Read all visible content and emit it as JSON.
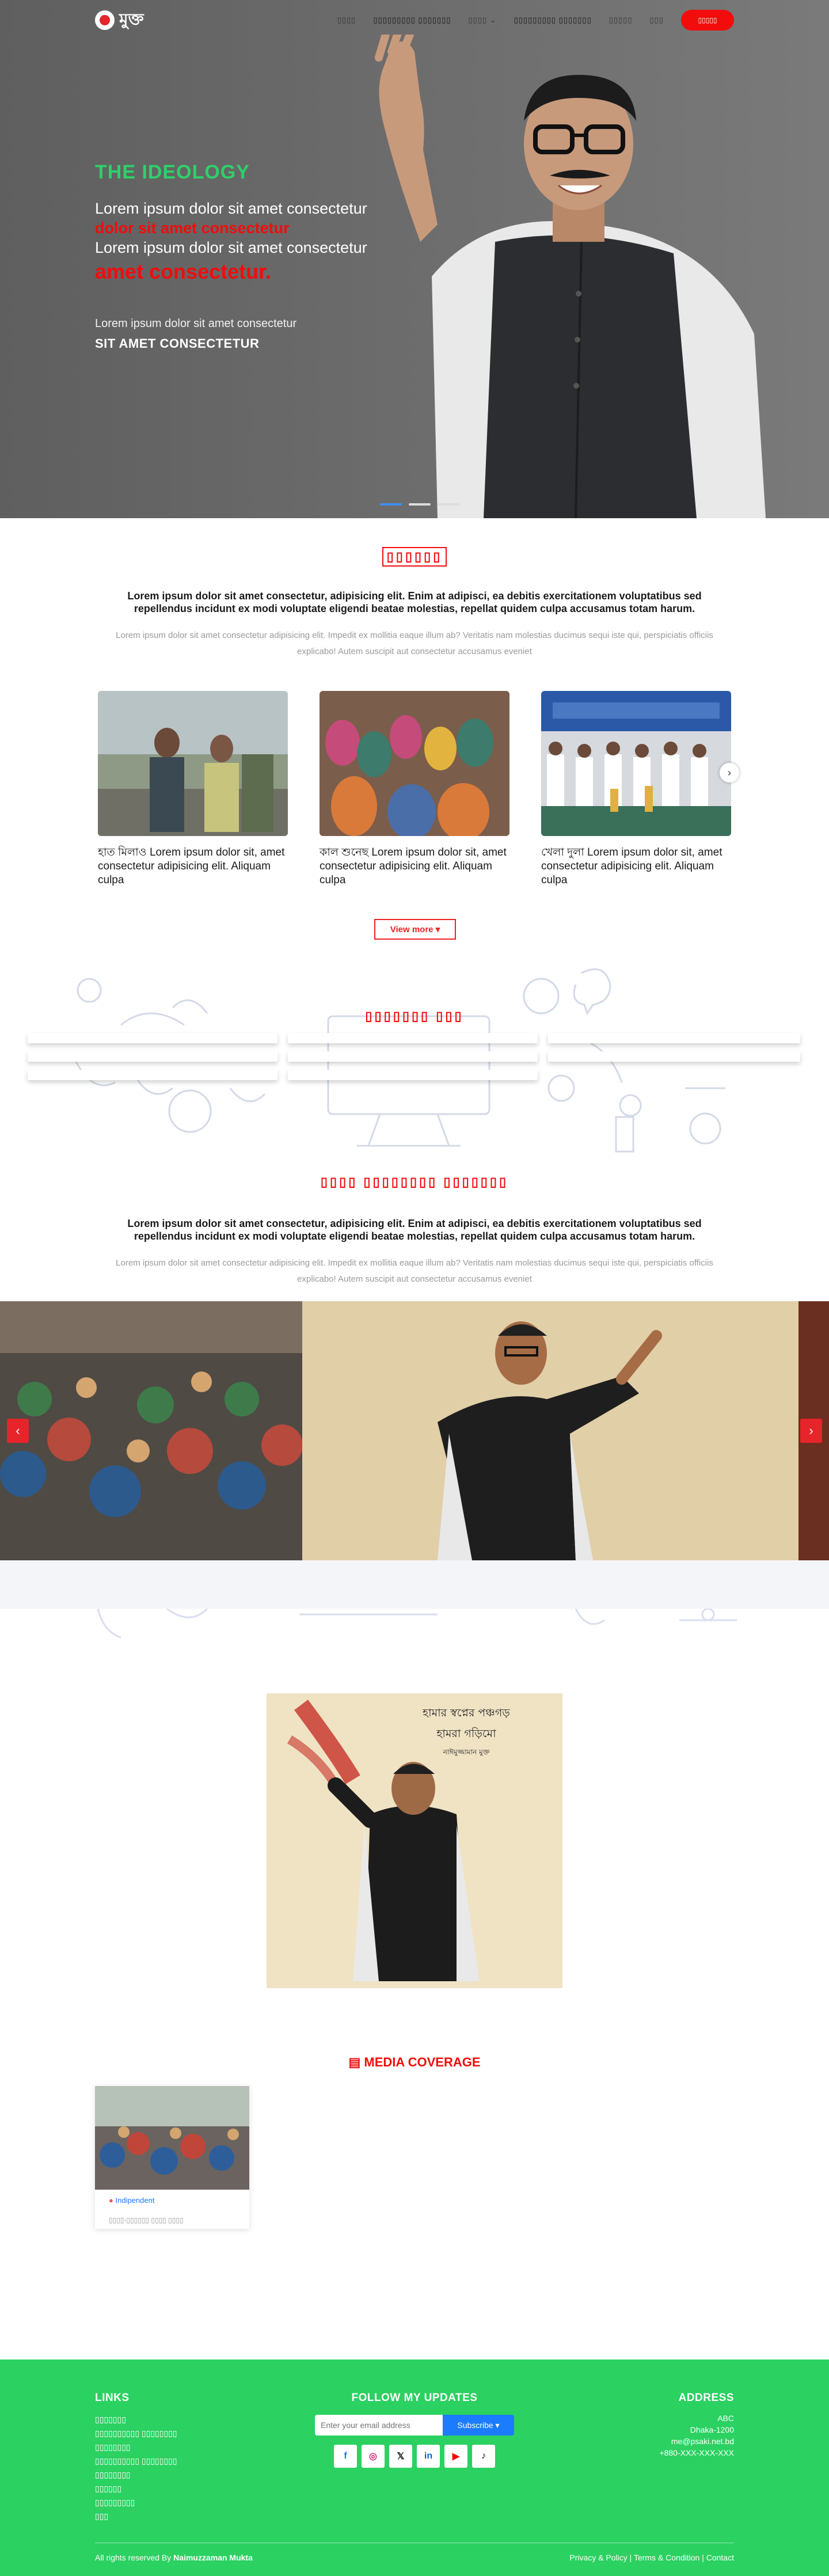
{
  "nav": {
    "logo_text": "মুক্ত",
    "menu": [
      "▯▯▯▯",
      "▯▯▯▯▯▯▯▯▯ ▯▯▯▯▯▯▯",
      "▯▯▯▯",
      "▯▯▯▯▯▯▯▯▯ ▯▯▯▯▯▯▯",
      "▯▯▯▯▯",
      "▯▯▯"
    ],
    "cta": "▯▯▯▯▯"
  },
  "hero": {
    "kicker": "THE IDEOLOGY",
    "line1": "Lorem ipsum dolor sit amet consectetur",
    "line2": "dolor sit amet consectetur",
    "line3": "Lorem ipsum dolor sit amet consectetur",
    "line4": "amet consectetur.",
    "sub": "Lorem ipsum dolor sit amet consectetur",
    "sub2": "SIT AMET CONSECTETUR",
    "slide_index": 1,
    "slide_count": 3
  },
  "about": {
    "title": "▯▯▯▯▯▯",
    "lead": "Lorem ipsum dolor sit amet consectetur, adipisicing elit. Enim at adipisci, ea debitis exercitationem voluptatibus sed repellendus incidunt ex modi voluptate eligendi beatae molestias, repellat quidem culpa accusamus totam harum.",
    "muted": "Lorem ipsum dolor sit amet consectetur adipisicing elit. Impedit ex mollitia eaque illum ab? Veritatis nam molestias ducimus sequi iste qui, perspiciatis officiis explicabo! Autem suscipit aut consectetur accusamus eveniet",
    "cards": [
      {
        "text": "হাত মিলাও Lorem ipsum dolor sit, amet consectetur adipisicing elit. Aliquam culpa"
      },
      {
        "text": "কাল শুনেছ Lorem ipsum dolor sit, amet consectetur adipisicing elit. Aliquam culpa"
      },
      {
        "text": "খেলা দুলা Lorem ipsum dolor sit, amet consectetur adipisicing elit. Aliquam culpa"
      }
    ],
    "view_more": "View more ▾"
  },
  "events": {
    "title": "▯▯▯▯▯▯▯ ▯▯▯"
  },
  "gallery": {
    "title": "▯▯▯▯  ▯▯▯▯▯▯▯▯  ▯▯▯▯▯▯▯",
    "lead": "Lorem ipsum dolor sit amet consectetur, adipisicing elit. Enim at adipisci, ea debitis exercitationem voluptatibus sed repellendus incidunt ex modi voluptate eligendi beatae molestias, repellat quidem culpa accusamus totam harum.",
    "muted": "Lorem ipsum dolor sit amet consectetur adipisicing elit. Impedit ex mollitia eaque illum ab? Veritatis nam molestias ducimus sequi iste qui, perspiciatis officiis explicabo! Autem suscipit aut consectetur accusamus eveniet"
  },
  "poster": {
    "line1": "হামার স্বপ্নের পঞ্চগড়",
    "line2": "হামরা গড়িমো",
    "line3": "নাঈমুজ্জামান মুক্ত"
  },
  "media": {
    "title": "MEDIA COVERAGE",
    "items": [
      {
        "source": "Indipendent",
        "headline": "▯▯▯▯-▯▯▯▯▯▯ ▯▯▯▯ ▯▯▯▯"
      }
    ]
  },
  "footer": {
    "links_title": "LINKS",
    "links": [
      "▯▯▯▯▯▯▯",
      "▯▯▯▯▯▯▯▯▯▯ ▯▯▯▯▯▯▯▯",
      "▯▯▯▯▯▯▯▯",
      "▯▯▯▯▯▯▯▯▯▯ ▯▯▯▯▯▯▯▯",
      "▯▯▯▯▯▯▯▯",
      "▯▯▯▯▯▯",
      "▯▯▯▯▯▯▯▯▯",
      "▯▯▯"
    ],
    "follow_title": "FOLLOW MY UPDATES",
    "email_placeholder": "Enter your email address",
    "subscribe": "Subscribe ▾",
    "address_title": "ADDRESS",
    "address": [
      "ABC",
      "Dhaka-1200",
      "me@psaki.net.bd",
      "+880-XXX-XXX-XXX"
    ],
    "copyright_prefix": "All rights reserved By ",
    "copyright_name": "Naimuzzaman Mukta",
    "legal": "Privacy & Policy | Terms & Condition | Contact"
  },
  "colors": {
    "accent_red": "#f20c0c",
    "accent_green": "#2bd161",
    "accent_blue": "#1b7cff"
  }
}
